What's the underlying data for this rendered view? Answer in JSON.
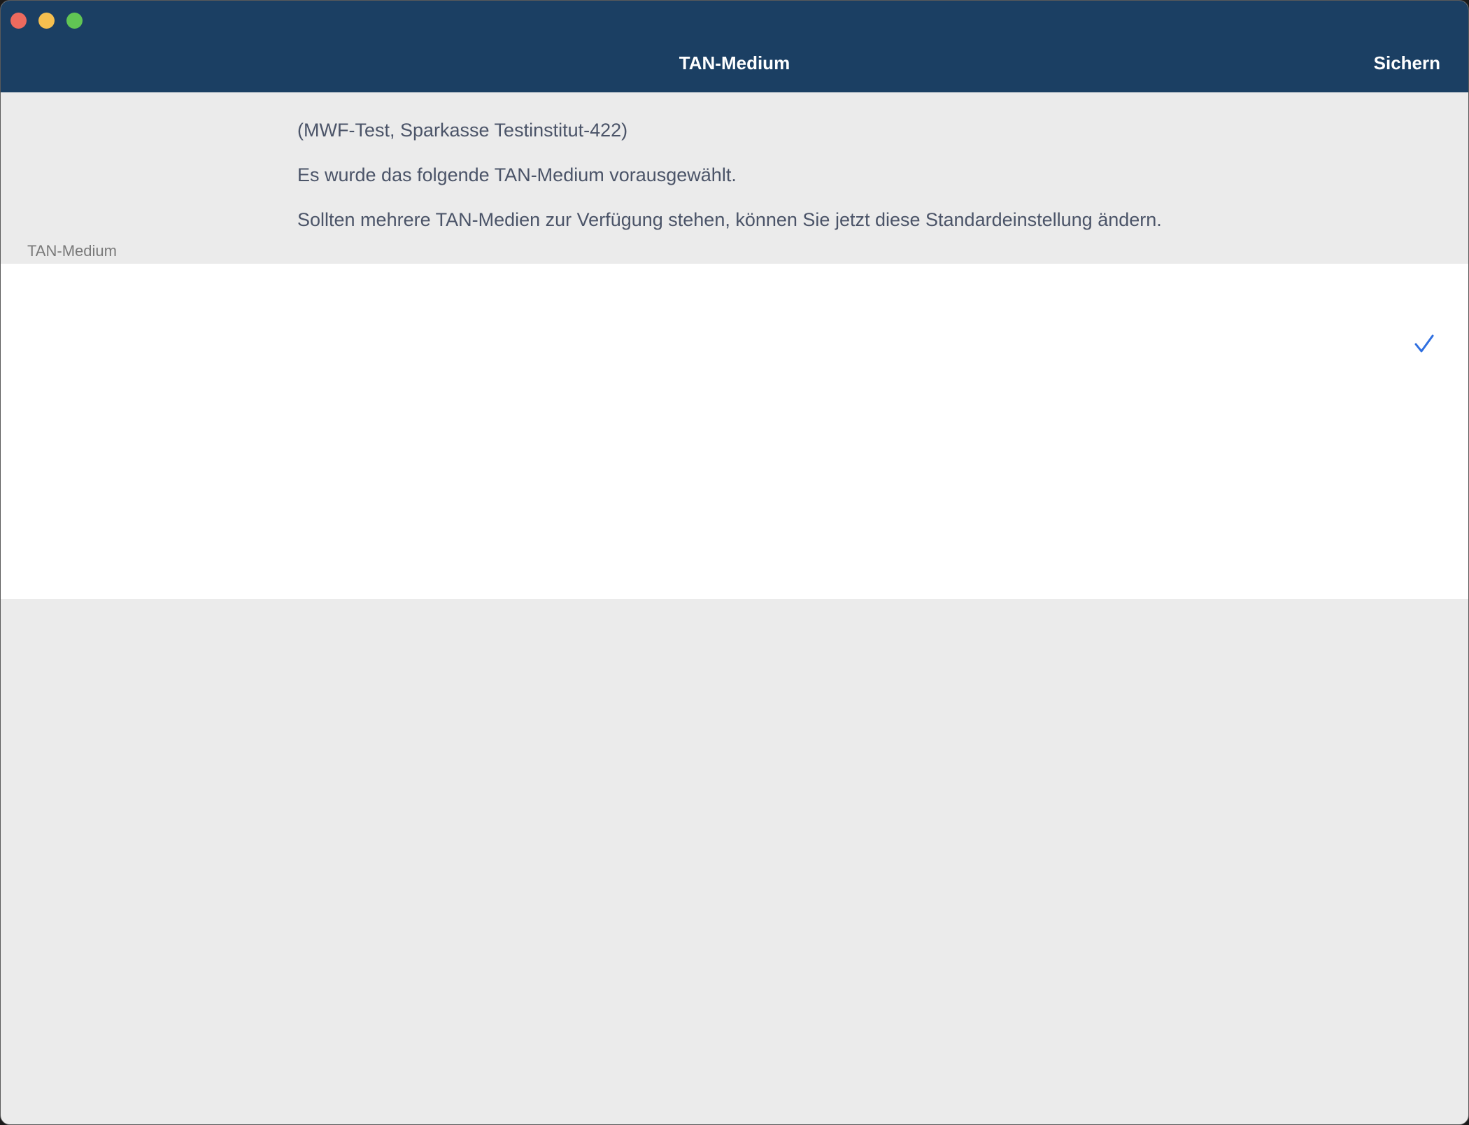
{
  "window": {
    "title": "TAN-Medium",
    "save_label": "Sichern"
  },
  "info": {
    "institute": "(MWF-Test, Sparkasse Testinstitut-422)",
    "preselected": "Es wurde das folgende TAN-Medium vorausgewählt.",
    "change_hint": "Sollten mehrere TAN-Medien zur Verfügung stehen, können Sie jetzt diese Standardeinstellung ändern."
  },
  "section": {
    "header": "TAN-Medium"
  },
  "list": {
    "items": [
      {
        "label": "",
        "selected": true,
        "icon": "checkmark-icon"
      }
    ]
  },
  "colors": {
    "titlebar": "#1b3f63",
    "background": "#ebebeb",
    "accent": "#2f6fe0",
    "body_text": "#4b5468"
  }
}
